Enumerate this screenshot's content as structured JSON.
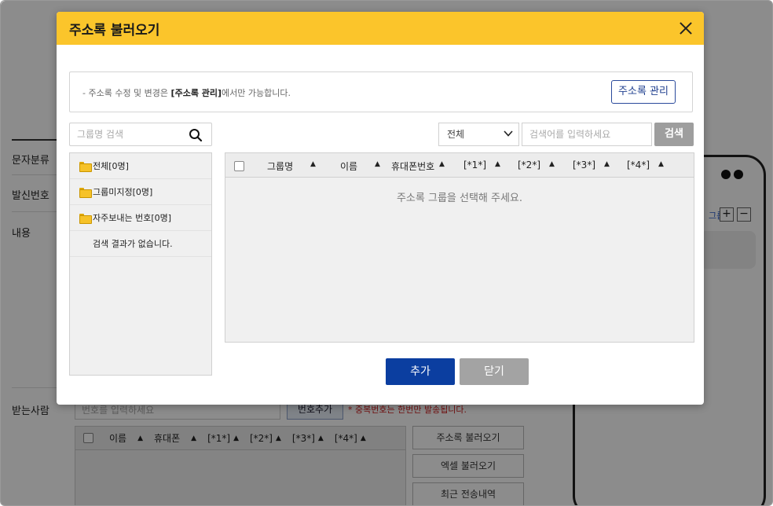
{
  "background": {
    "labels": [
      "문자분류",
      "발신번호",
      "내용",
      "받는사람"
    ],
    "number_input_placeholder": "번호를 입력하세요",
    "add_number_label": "번호추가",
    "warning": "* 중복번호는 한번만 발송됩니다.",
    "table_headers": [
      "이름",
      "휴대폰",
      "[*1*]",
      "[*2*]",
      "[*3*]",
      "[*4*]"
    ],
    "side_buttons": [
      "주소록 불러오기",
      "엑셀 불러오기",
      "최근 전송내역"
    ],
    "phone_link": "그룹",
    "phone_plus": "+",
    "phone_minus": "−"
  },
  "modal": {
    "title": "주소록 불러오기",
    "notice_prefix": "- 주소록 수정 및 변경은 ",
    "notice_bold": "[주소록 관리]",
    "notice_suffix": "에서만 가능합니다.",
    "manage_button": "주소록 관리",
    "group_search_placeholder": "그룹명 검색",
    "groups": [
      "전체[0명]",
      "그룹미지정[0명]",
      "자주보내는 번호[0명]"
    ],
    "no_results": "검색 결과가 없습니다.",
    "filter_selected": "전체",
    "keyword_placeholder": "검색어를 입력하세요",
    "search_button": "검색",
    "columns": [
      "그룹명",
      "이름",
      "휴대폰번호",
      "[*1*]",
      "[*2*]",
      "[*3*]",
      "[*4*]"
    ],
    "sort_glyph": "▲",
    "empty_message": "주소록 그룹을 선택해 주세요.",
    "add_button": "추가",
    "close_button": "닫기"
  }
}
